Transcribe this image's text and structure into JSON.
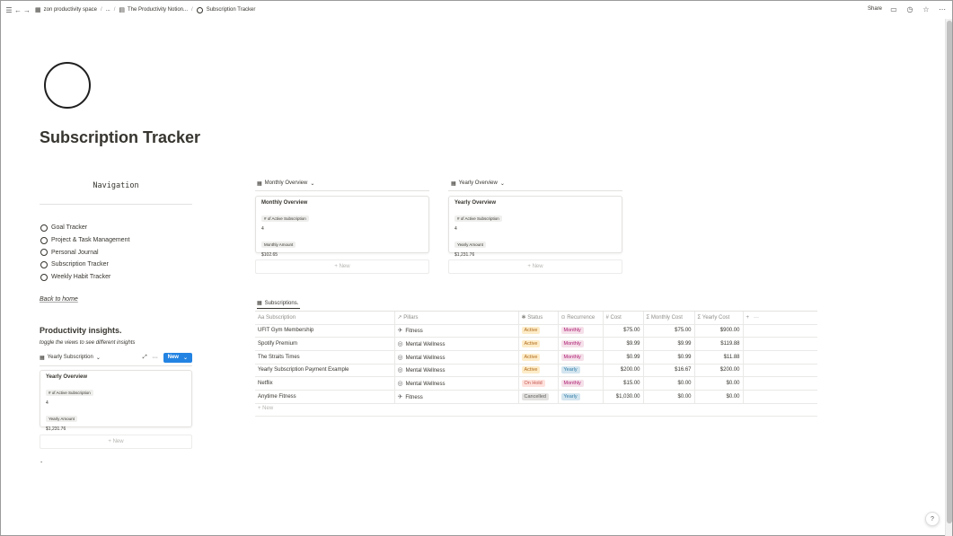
{
  "topbar": {
    "workspace": "zon productivity space",
    "ellipsis": "...",
    "parent": "The Productivity Notion...",
    "current": "Subscription Tracker",
    "share": "Share"
  },
  "page": {
    "title": "Subscription Tracker"
  },
  "navigation": {
    "heading": "Navigation",
    "items": [
      "Goal Tracker",
      "Project & Task Management",
      "Personal Journal",
      "Subscription Tracker",
      "Weekly Habit Tracker"
    ],
    "back_link": "Back to home"
  },
  "insights": {
    "title": "Productivity insights.",
    "subtitle": "toggle the views to see different insights",
    "view_label": "Yearly Subscription",
    "new_label": "New",
    "card": {
      "title": "Yearly Overview",
      "tag1": "# of Active Subscription",
      "val1": "4",
      "tag2": "Yearly Amount",
      "val2": "$1,231.76"
    },
    "new_row": "+ New",
    "dash": "-"
  },
  "monthly": {
    "view_label": "Monthly Overview",
    "card": {
      "title": "Monthly Overview",
      "tag1": "# of Active Subscription",
      "val1": "4",
      "tag2": "Monthly Amount",
      "val2": "$102.65"
    },
    "new_row": "+ New"
  },
  "yearly": {
    "view_label": "Yearly Overview",
    "card": {
      "title": "Yearly Overview",
      "tag1": "# of Active Subscription",
      "val1": "4",
      "tag2": "Yearly Amount",
      "val2": "$1,231.76"
    },
    "new_row": "+ New"
  },
  "table": {
    "tab": "Subscriptions.",
    "headers": {
      "subscription": "Subscription",
      "pillars": "Pillars",
      "status": "Status",
      "recurrence": "Recurrence",
      "cost": "Cost",
      "monthly": "Monthly Cost",
      "yearly": "Yearly Cost",
      "add": "+",
      "more": "···"
    },
    "rows": [
      {
        "name": "UFIT Gym Membership",
        "pillar": "Fitness",
        "status": "Active",
        "recurrence": "Monthly",
        "cost": "$75.00",
        "monthly": "$75.00",
        "yearly": "$900.00"
      },
      {
        "name": "Spotify Premium",
        "pillar": "Mental Wellness",
        "status": "Active",
        "recurrence": "Monthly",
        "cost": "$9.99",
        "monthly": "$9.99",
        "yearly": "$119.88"
      },
      {
        "name": "The Straits Times",
        "pillar": "Mental Wellness",
        "status": "Active",
        "recurrence": "Monthly",
        "cost": "$0.99",
        "monthly": "$0.99",
        "yearly": "$11.88"
      },
      {
        "name": "Yearly Subscription Payment Example",
        "pillar": "Mental Wellness",
        "status": "Active",
        "recurrence": "Yearly",
        "cost": "$200.00",
        "monthly": "$16.67",
        "yearly": "$200.00"
      },
      {
        "name": "Netflix",
        "pillar": "Mental Wellness",
        "status": "On Hold",
        "recurrence": "Monthly",
        "cost": "$15.00",
        "monthly": "$0.00",
        "yearly": "$0.00"
      },
      {
        "name": "Anytime Fitness",
        "pillar": "Fitness",
        "status": "Cancelled",
        "recurrence": "Yearly",
        "cost": "$1,030.00",
        "monthly": "$0.00",
        "yearly": "$0.00"
      }
    ],
    "new_row": "+ New"
  },
  "colors": {
    "Active": {
      "bg": "#fdecc8",
      "fg": "#b06a1a"
    },
    "On Hold": {
      "bg": "#ffe2dd",
      "fg": "#c4554d"
    },
    "Cancelled": {
      "bg": "#e3e2e0",
      "fg": "#5f5e5b"
    },
    "Monthly": {
      "bg": "#f5e0e9",
      "fg": "#ad1a72"
    },
    "Yearly": {
      "bg": "#d3e5ef",
      "fg": "#337ea9"
    }
  },
  "icons": {
    "Fitness": "runner-icon",
    "Mental Wellness": "brain-icon"
  },
  "help": "?"
}
